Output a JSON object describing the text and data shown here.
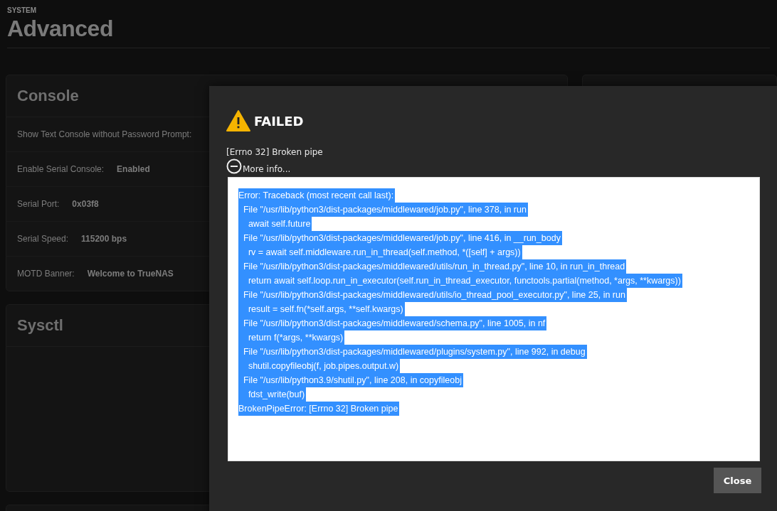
{
  "page": {
    "breadcrumb": "SYSTEM",
    "title": "Advanced"
  },
  "console_card": {
    "title": "Console",
    "rows": [
      {
        "label": "Show Text Console without Password Prompt:"
      },
      {
        "label": "Enable Serial Console:",
        "value": "Enabled"
      },
      {
        "label": "Serial Port:",
        "value": "0x03f8"
      },
      {
        "label": "Serial Speed:",
        "value": "115200 bps"
      },
      {
        "label": "MOTD Banner:",
        "value": "Welcome to TrueNAS"
      }
    ]
  },
  "sysctl_card": {
    "title": "Sysctl"
  },
  "dialog": {
    "title": "FAILED",
    "message": "[Errno 32] Broken pipe",
    "more_info": {
      "label": "More info...",
      "expanded": true
    },
    "traceback": {
      "selected": true,
      "lines": [
        "Error: Traceback (most recent call last):",
        "  File \"/usr/lib/python3/dist-packages/middlewared/job.py\", line 378, in run",
        "    await self.future",
        "  File \"/usr/lib/python3/dist-packages/middlewared/job.py\", line 416, in __run_body",
        "    rv = await self.middleware.run_in_thread(self.method, *([self] + args))",
        "  File \"/usr/lib/python3/dist-packages/middlewared/utils/run_in_thread.py\", line 10, in run_in_thread",
        "    return await self.loop.run_in_executor(self.run_in_thread_executor, functools.partial(method, *args, **kwargs))",
        "  File \"/usr/lib/python3/dist-packages/middlewared/utils/io_thread_pool_executor.py\", line 25, in run",
        "    result = self.fn(*self.args, **self.kwargs)",
        "  File \"/usr/lib/python3/dist-packages/middlewared/schema.py\", line 1005, in nf",
        "    return f(*args, **kwargs)",
        "  File \"/usr/lib/python3/dist-packages/middlewared/plugins/system.py\", line 992, in debug",
        "    shutil.copyfileobj(f, job.pipes.output.w)",
        "  File \"/usr/lib/python3.9/shutil.py\", line 208, in copyfileobj",
        "    fdst_write(buf)",
        "BrokenPipeError: [Errno 32] Broken pipe"
      ]
    },
    "buttons": [
      "Close"
    ]
  }
}
